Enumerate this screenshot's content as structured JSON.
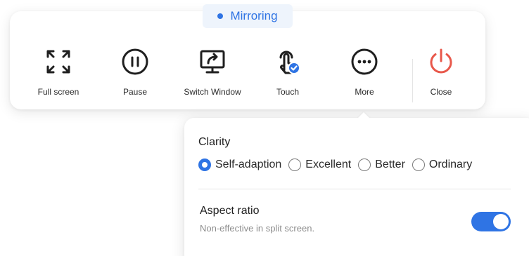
{
  "status": {
    "label": "Mirroring",
    "accent": "#2f74e4"
  },
  "toolbar": {
    "items": [
      {
        "label": "Full screen",
        "icon": "fullscreen-icon"
      },
      {
        "label": "Pause",
        "icon": "pause-icon"
      },
      {
        "label": "Switch Window",
        "icon": "switch-window-icon"
      },
      {
        "label": "Touch",
        "icon": "touch-icon"
      },
      {
        "label": "More",
        "icon": "more-icon"
      },
      {
        "label": "Close",
        "icon": "power-icon",
        "color": "#e8584b"
      }
    ]
  },
  "panel": {
    "clarity": {
      "title": "Clarity",
      "options": [
        "Self-adaption",
        "Excellent",
        "Better",
        "Ordinary"
      ],
      "selected": "Self-adaption"
    },
    "aspect_ratio": {
      "title": "Aspect ratio",
      "subtitle": "Non-effective in split screen.",
      "enabled": true
    }
  }
}
